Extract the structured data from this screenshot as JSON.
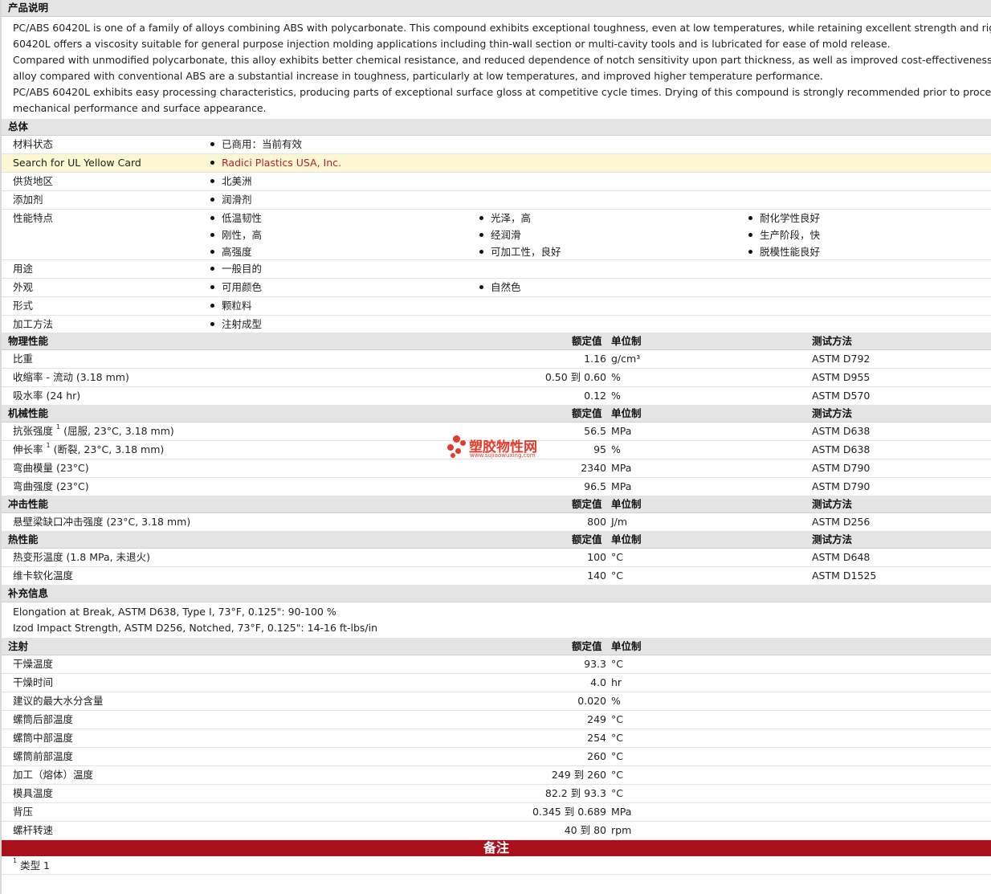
{
  "colors": {
    "header_bg": "#e4e4e4",
    "highlight_row": "#fcf7d2",
    "link": "#b0232a",
    "notes_bar": "#a8101c",
    "watermark": "#e53a2a"
  },
  "description": {
    "title": "产品说明",
    "lines": [
      "PC/ABS 60420L is one of a family of alloys combining ABS with polycarbonate. This compound exhibits exceptional toughness, even at low temperatures, while retaining excellent strength and rigidity. PC/ABS",
      "60420L offers a viscosity suitable for general purpose injection molding applications including thin-wall section or multi-cavity tools and is lubricated for ease of mold release.",
      "Compared with unmodified polycarbonate, this alloy exhibits better chemical resistance, and reduced dependence of notch sensitivity upon part thickness, as well as improved cost-effectiveness. The benefits of this",
      "alloy compared with conventional ABS are a substantial increase in toughness, particularly at low temperatures, and improved higher temperature performance.",
      "PC/ABS 60420L exhibits easy processing characteristics, producing parts of exceptional surface gloss at competitive cycle times. Drying of this compound is strongly recommended prior to processing, to optimize",
      "mechanical performance and surface appearance."
    ]
  },
  "general": {
    "title": "总体",
    "material_status": {
      "label": "材料状态",
      "value": "已商用：当前有效"
    },
    "ul_card": {
      "label": "Search for UL Yellow Card",
      "value": "Radici Plastics USA, Inc."
    },
    "region": {
      "label": "供货地区",
      "value": "北美洲"
    },
    "additive": {
      "label": "添加剂",
      "value": "润滑剂"
    },
    "features": {
      "label": "性能特点",
      "col1": [
        "低温韧性",
        "刚性，高",
        "高强度"
      ],
      "col2": [
        "光泽，高",
        "经润滑",
        "可加工性，良好"
      ],
      "col3": [
        "耐化学性良好",
        "生产阶段，快",
        "脱模性能良好"
      ]
    },
    "uses": {
      "label": "用途",
      "value": "一般目的"
    },
    "appearance": {
      "label": "外观",
      "value1": "可用颜色",
      "value2": "自然色"
    },
    "form": {
      "label": "形式",
      "value": "颗粒料"
    },
    "processing": {
      "label": "加工方法",
      "value": "注射成型"
    }
  },
  "col_headers": {
    "value": "额定值",
    "unit": "单位制",
    "method": "测试方法"
  },
  "physical": {
    "title": "物理性能",
    "rows": [
      {
        "prop": "比重",
        "val": "1.16",
        "unit": "g/cm³",
        "method": "ASTM D792"
      },
      {
        "prop": "收缩率 - 流动 (3.18 mm)",
        "val": "0.50 到 0.60",
        "unit": "%",
        "method": "ASTM D955"
      },
      {
        "prop": "吸水率 (24 hr)",
        "val": "0.12",
        "unit": "%",
        "method": "ASTM D570"
      }
    ]
  },
  "mechanical": {
    "title": "机械性能",
    "rows": [
      {
        "prop": "抗张强度",
        "sup": "1",
        "cond": "(屈服, 23°C, 3.18 mm)",
        "val": "56.5",
        "unit": "MPa",
        "method": "ASTM D638"
      },
      {
        "prop": "伸长率",
        "sup": "1",
        "cond": "(断裂, 23°C, 3.18 mm)",
        "val": "95",
        "unit": "%",
        "method": "ASTM D638"
      },
      {
        "prop": "弯曲模量 (23°C)",
        "val": "2340",
        "unit": "MPa",
        "method": "ASTM D790"
      },
      {
        "prop": "弯曲强度 (23°C)",
        "val": "96.5",
        "unit": "MPa",
        "method": "ASTM D790"
      }
    ]
  },
  "impact": {
    "title": "冲击性能",
    "rows": [
      {
        "prop": "悬壁梁缺口冲击强度 (23°C, 3.18 mm)",
        "val": "800",
        "unit": "J/m",
        "method": "ASTM D256"
      }
    ]
  },
  "thermal": {
    "title": "热性能",
    "rows": [
      {
        "prop": "热变形温度 (1.8 MPa, 未退火)",
        "val": "100",
        "unit": "°C",
        "method": "ASTM D648"
      },
      {
        "prop": "维卡软化温度",
        "val": "140",
        "unit": "°C",
        "method": "ASTM D1525"
      }
    ]
  },
  "supplement": {
    "title": "补充信息",
    "lines": [
      "Elongation at Break, ASTM D638, Type I, 73°F, 0.125\": 90-100 %",
      "Izod Impact Strength, ASTM D256, Notched, 73°F, 0.125\": 14-16 ft-lbs/in"
    ]
  },
  "injection": {
    "title": "注射",
    "rows": [
      {
        "prop": "干燥温度",
        "val": "93.3",
        "unit": "°C"
      },
      {
        "prop": "干燥时间",
        "val": "4.0",
        "unit": "hr"
      },
      {
        "prop": "建议的最大水分含量",
        "val": "0.020",
        "unit": "%"
      },
      {
        "prop": "螺筒后部温度",
        "val": "249",
        "unit": "°C"
      },
      {
        "prop": "螺筒中部温度",
        "val": "254",
        "unit": "°C"
      },
      {
        "prop": "螺筒前部温度",
        "val": "260",
        "unit": "°C"
      },
      {
        "prop": "加工（熔体）温度",
        "val": "249 到 260",
        "unit": "°C"
      },
      {
        "prop": "模具温度",
        "val": "82.2 到 93.3",
        "unit": "°C"
      },
      {
        "prop": "背压",
        "val": "0.345 到 0.689",
        "unit": "MPa"
      },
      {
        "prop": "螺杆转速",
        "val": "40 到 80",
        "unit": "rpm"
      }
    ]
  },
  "notes": {
    "title": "备注",
    "footnote_num": "1",
    "footnote_text": "类型 1"
  },
  "watermark": {
    "name": "塑胶物性网",
    "url": "www.sujiaowuxing.com"
  }
}
